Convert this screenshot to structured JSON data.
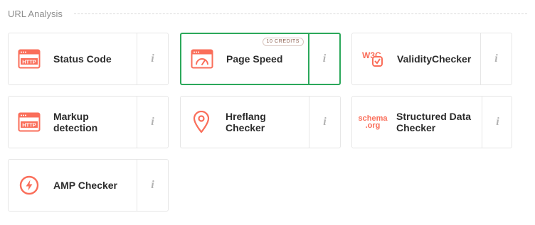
{
  "section": {
    "title": "URL Analysis"
  },
  "accent_color": "#fa6e5a",
  "selected_color": "#2ba85a",
  "cards": [
    {
      "label": "Status Code",
      "icon": "http-icon",
      "icon_text": "HTTP",
      "info": "i"
    },
    {
      "label": "Page Speed",
      "icon": "speedometer-icon",
      "info": "i",
      "badge": "10 CREDITS",
      "selected": true
    },
    {
      "label": "ValidityChecker",
      "icon": "w3c-icon",
      "icon_text": "W3C",
      "info": "i"
    },
    {
      "label": "Markup detection",
      "icon": "http-icon",
      "icon_text": "HTTP",
      "info": "i"
    },
    {
      "label": "Hreflang Checker",
      "icon": "location-pin-icon",
      "info": "i"
    },
    {
      "label": "Structured Data Checker",
      "icon": "schema-org-icon",
      "icon_text": "schema",
      "icon_text2": ".org",
      "info": "i"
    },
    {
      "label": "AMP Checker",
      "icon": "amp-lightning-icon",
      "info": "i"
    }
  ]
}
